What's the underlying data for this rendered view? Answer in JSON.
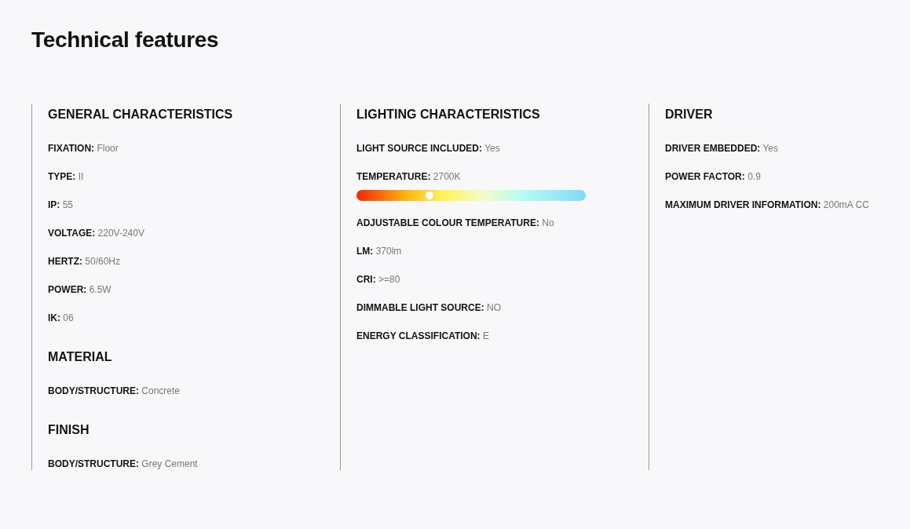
{
  "title": "Technical features",
  "columns": [
    {
      "sections": [
        {
          "heading": "GENERAL CHARACTERISTICS",
          "items": [
            {
              "kind": "text",
              "label": "FIXATION:",
              "value": "Floor"
            },
            {
              "kind": "text",
              "label": "TYPE:",
              "value": "II"
            },
            {
              "kind": "text",
              "label": "IP:",
              "value": "55"
            },
            {
              "kind": "text",
              "label": "VOLTAGE:",
              "value": "220V-240V"
            },
            {
              "kind": "text",
              "label": "HERTZ:",
              "value": "50/60Hz"
            },
            {
              "kind": "text",
              "label": "POWER:",
              "value": "6.5W"
            },
            {
              "kind": "text",
              "label": "IK:",
              "value": "06"
            }
          ]
        },
        {
          "heading": "MATERIAL",
          "items": [
            {
              "kind": "text",
              "label": "BODY/STRUCTURE:",
              "value": "Concrete"
            }
          ]
        },
        {
          "heading": "FINISH",
          "items": [
            {
              "kind": "text",
              "label": "BODY/STRUCTURE:",
              "value": "Grey Cement"
            }
          ]
        }
      ]
    },
    {
      "sections": [
        {
          "heading": "LIGHTING CHARACTERISTICS",
          "items": [
            {
              "kind": "text",
              "label": "LIGHT SOURCE INCLUDED:",
              "value": "Yes"
            },
            {
              "kind": "scale",
              "label": "TEMPERATURE:",
              "value": "2700K",
              "level": 0.32
            },
            {
              "kind": "text",
              "label": "ADJUSTABLE COLOUR TEMPERATURE:",
              "value": "No"
            },
            {
              "kind": "text",
              "label": "LM:",
              "value": "370lm"
            },
            {
              "kind": "text",
              "label": "CRI:",
              "value": ">=80"
            },
            {
              "kind": "text",
              "label": "DIMMABLE LIGHT SOURCE:",
              "value": "NO"
            },
            {
              "kind": "text",
              "label": "ENERGY CLASSIFICATION:",
              "value": "E"
            }
          ]
        }
      ]
    },
    {
      "sections": [
        {
          "heading": "DRIVER",
          "items": [
            {
              "kind": "text",
              "label": "DRIVER EMBEDDED:",
              "value": "Yes"
            },
            {
              "kind": "text",
              "label": "POWER FACTOR:",
              "value": "0.9"
            },
            {
              "kind": "text",
              "label": "MAXIMUM DRIVER INFORMATION:",
              "value": "200mA CC"
            }
          ]
        }
      ]
    }
  ]
}
